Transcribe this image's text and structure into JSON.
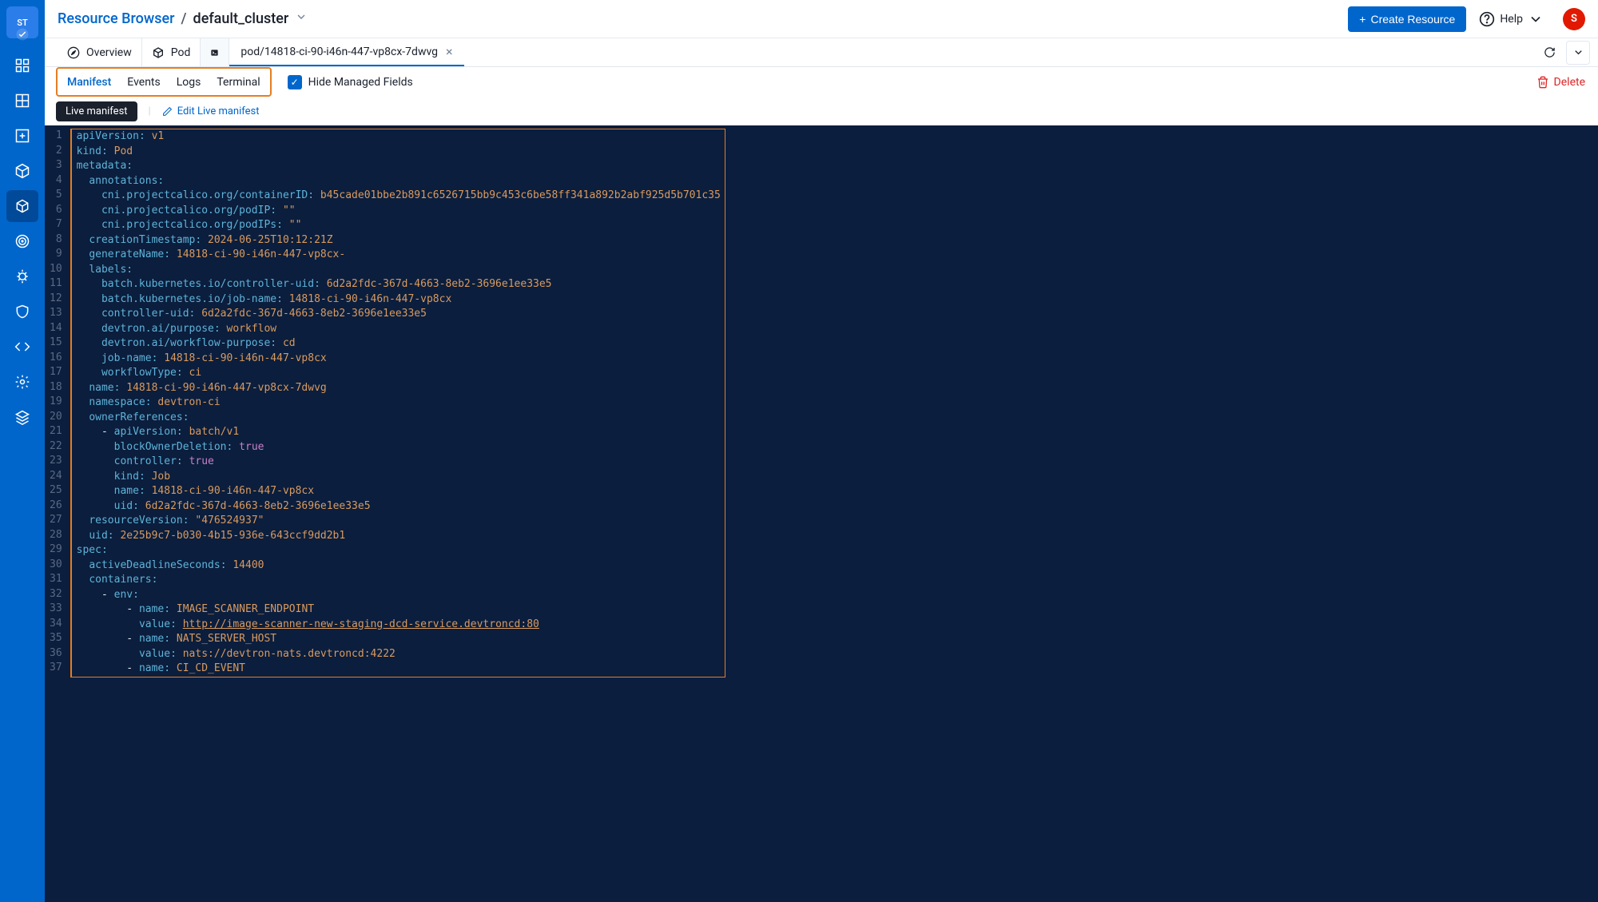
{
  "sidebar": {
    "logo_text": "ST"
  },
  "header": {
    "breadcrumb_root": "Resource Browser",
    "breadcrumb_sep": "/",
    "breadcrumb_current": "default_cluster",
    "create_button": "Create Resource",
    "help_label": "Help",
    "avatar_initial": "S"
  },
  "context_tabs": {
    "overview": "Overview",
    "pod": "Pod",
    "open_tab": "pod/14818-ci-90-i46n-447-vp8cx-7dwvg"
  },
  "subtabs": {
    "manifest": "Manifest",
    "events": "Events",
    "logs": "Logs",
    "terminal": "Terminal",
    "hide_managed": "Hide Managed Fields",
    "delete": "Delete"
  },
  "manifest_bar": {
    "live": "Live manifest",
    "edit": "Edit Live manifest"
  },
  "yaml": [
    [
      [
        "k",
        "apiVersion"
      ],
      [
        "p",
        ": "
      ],
      [
        "s",
        "v1"
      ]
    ],
    [
      [
        "k",
        "kind"
      ],
      [
        "p",
        ": "
      ],
      [
        "s",
        "Pod"
      ]
    ],
    [
      [
        "k",
        "metadata"
      ],
      [
        "p",
        ":"
      ]
    ],
    [
      [
        "pad",
        "  "
      ],
      [
        "k",
        "annotations"
      ],
      [
        "p",
        ":"
      ]
    ],
    [
      [
        "pad",
        "    "
      ],
      [
        "k",
        "cni.projectcalico.org/containerID"
      ],
      [
        "p",
        ": "
      ],
      [
        "s",
        "b45cade01bbe2b891c6526715bb9c453c6be58ff341a892b2abf925d5b701c35"
      ]
    ],
    [
      [
        "pad",
        "    "
      ],
      [
        "k",
        "cni.projectcalico.org/podIP"
      ],
      [
        "p",
        ": "
      ],
      [
        "s",
        "\"\""
      ]
    ],
    [
      [
        "pad",
        "    "
      ],
      [
        "k",
        "cni.projectcalico.org/podIPs"
      ],
      [
        "p",
        ": "
      ],
      [
        "s",
        "\"\""
      ]
    ],
    [
      [
        "pad",
        "  "
      ],
      [
        "k",
        "creationTimestamp"
      ],
      [
        "p",
        ": "
      ],
      [
        "s",
        "2024-06-25T10:12:21Z"
      ]
    ],
    [
      [
        "pad",
        "  "
      ],
      [
        "k",
        "generateName"
      ],
      [
        "p",
        ": "
      ],
      [
        "s",
        "14818-ci-90-i46n-447-vp8cx-"
      ]
    ],
    [
      [
        "pad",
        "  "
      ],
      [
        "k",
        "labels"
      ],
      [
        "p",
        ":"
      ]
    ],
    [
      [
        "pad",
        "    "
      ],
      [
        "k",
        "batch.kubernetes.io/controller-uid"
      ],
      [
        "p",
        ": "
      ],
      [
        "s",
        "6d2a2fdc-367d-4663-8eb2-3696e1ee33e5"
      ]
    ],
    [
      [
        "pad",
        "    "
      ],
      [
        "k",
        "batch.kubernetes.io/job-name"
      ],
      [
        "p",
        ": "
      ],
      [
        "s",
        "14818-ci-90-i46n-447-vp8cx"
      ]
    ],
    [
      [
        "pad",
        "    "
      ],
      [
        "k",
        "controller-uid"
      ],
      [
        "p",
        ": "
      ],
      [
        "s",
        "6d2a2fdc-367d-4663-8eb2-3696e1ee33e5"
      ]
    ],
    [
      [
        "pad",
        "    "
      ],
      [
        "k",
        "devtron.ai/purpose"
      ],
      [
        "p",
        ": "
      ],
      [
        "s",
        "workflow"
      ]
    ],
    [
      [
        "pad",
        "    "
      ],
      [
        "k",
        "devtron.ai/workflow-purpose"
      ],
      [
        "p",
        ": "
      ],
      [
        "s",
        "cd"
      ]
    ],
    [
      [
        "pad",
        "    "
      ],
      [
        "k",
        "job-name"
      ],
      [
        "p",
        ": "
      ],
      [
        "s",
        "14818-ci-90-i46n-447-vp8cx"
      ]
    ],
    [
      [
        "pad",
        "    "
      ],
      [
        "k",
        "workflowType"
      ],
      [
        "p",
        ": "
      ],
      [
        "s",
        "ci"
      ]
    ],
    [
      [
        "pad",
        "  "
      ],
      [
        "k",
        "name"
      ],
      [
        "p",
        ": "
      ],
      [
        "s",
        "14818-ci-90-i46n-447-vp8cx-7dwvg"
      ]
    ],
    [
      [
        "pad",
        "  "
      ],
      [
        "k",
        "namespace"
      ],
      [
        "p",
        ": "
      ],
      [
        "s",
        "devtron-ci"
      ]
    ],
    [
      [
        "pad",
        "  "
      ],
      [
        "k",
        "ownerReferences"
      ],
      [
        "p",
        ":"
      ]
    ],
    [
      [
        "pad",
        "    "
      ],
      [
        "dash",
        "- "
      ],
      [
        "k",
        "apiVersion"
      ],
      [
        "p",
        ": "
      ],
      [
        "s",
        "batch/v1"
      ]
    ],
    [
      [
        "pad",
        "      "
      ],
      [
        "k",
        "blockOwnerDeletion"
      ],
      [
        "p",
        ": "
      ],
      [
        "b",
        "true"
      ]
    ],
    [
      [
        "pad",
        "      "
      ],
      [
        "k",
        "controller"
      ],
      [
        "p",
        ": "
      ],
      [
        "b",
        "true"
      ]
    ],
    [
      [
        "pad",
        "      "
      ],
      [
        "k",
        "kind"
      ],
      [
        "p",
        ": "
      ],
      [
        "s",
        "Job"
      ]
    ],
    [
      [
        "pad",
        "      "
      ],
      [
        "k",
        "name"
      ],
      [
        "p",
        ": "
      ],
      [
        "s",
        "14818-ci-90-i46n-447-vp8cx"
      ]
    ],
    [
      [
        "pad",
        "      "
      ],
      [
        "k",
        "uid"
      ],
      [
        "p",
        ": "
      ],
      [
        "s",
        "6d2a2fdc-367d-4663-8eb2-3696e1ee33e5"
      ]
    ],
    [
      [
        "pad",
        "  "
      ],
      [
        "k",
        "resourceVersion"
      ],
      [
        "p",
        ": "
      ],
      [
        "s",
        "\"476524937\""
      ]
    ],
    [
      [
        "pad",
        "  "
      ],
      [
        "k",
        "uid"
      ],
      [
        "p",
        ": "
      ],
      [
        "s",
        "2e25b9c7-b030-4b15-936e-643ccf9dd2b1"
      ]
    ],
    [
      [
        "k",
        "spec"
      ],
      [
        "p",
        ":"
      ]
    ],
    [
      [
        "pad",
        "  "
      ],
      [
        "k",
        "activeDeadlineSeconds"
      ],
      [
        "p",
        ": "
      ],
      [
        "n",
        "14400"
      ]
    ],
    [
      [
        "pad",
        "  "
      ],
      [
        "k",
        "containers"
      ],
      [
        "p",
        ":"
      ]
    ],
    [
      [
        "pad",
        "    "
      ],
      [
        "dash",
        "- "
      ],
      [
        "k",
        "env"
      ],
      [
        "p",
        ":"
      ]
    ],
    [
      [
        "pad",
        "        "
      ],
      [
        "dash",
        "- "
      ],
      [
        "k",
        "name"
      ],
      [
        "p",
        ": "
      ],
      [
        "s",
        "IMAGE_SCANNER_ENDPOINT"
      ]
    ],
    [
      [
        "pad",
        "          "
      ],
      [
        "k",
        "value"
      ],
      [
        "p",
        ": "
      ],
      [
        "u",
        "http://image-scanner-new-staging-dcd-service.devtroncd:80"
      ]
    ],
    [
      [
        "pad",
        "        "
      ],
      [
        "dash",
        "- "
      ],
      [
        "k",
        "name"
      ],
      [
        "p",
        ": "
      ],
      [
        "s",
        "NATS_SERVER_HOST"
      ]
    ],
    [
      [
        "pad",
        "          "
      ],
      [
        "k",
        "value"
      ],
      [
        "p",
        ": "
      ],
      [
        "s",
        "nats://devtron-nats.devtroncd:4222"
      ]
    ],
    [
      [
        "pad",
        "        "
      ],
      [
        "dash",
        "- "
      ],
      [
        "k",
        "name"
      ],
      [
        "p",
        ": "
      ],
      [
        "s",
        "CI_CD_EVENT"
      ]
    ]
  ]
}
